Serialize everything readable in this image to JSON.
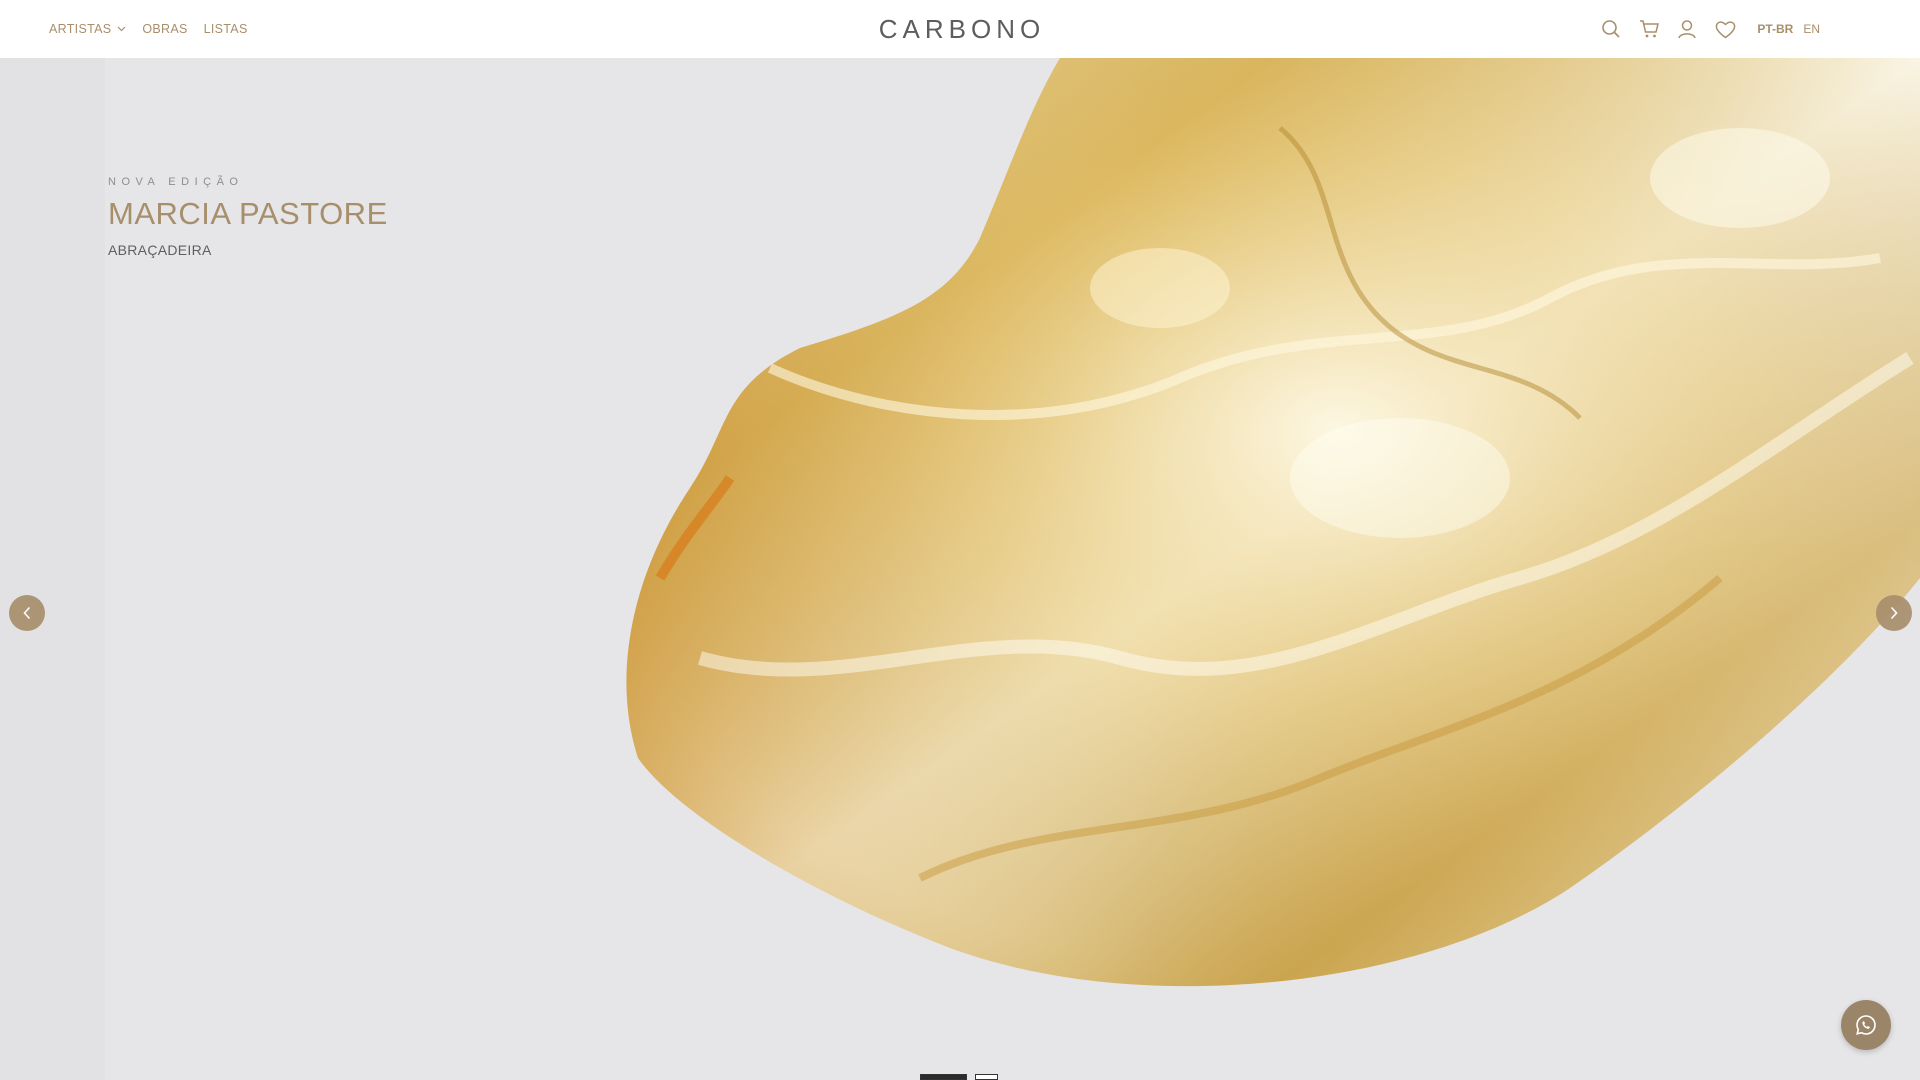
{
  "header": {
    "logo": "CARBONO",
    "nav": [
      {
        "label": "ARTISTAS",
        "has_dropdown": true
      },
      {
        "label": "OBRAS",
        "has_dropdown": false
      },
      {
        "label": "LISTAS",
        "has_dropdown": false
      }
    ],
    "tools": [
      "search-icon",
      "cart-icon",
      "user-icon",
      "heart-icon"
    ],
    "languages": [
      {
        "label": "PT-BR",
        "active": true
      },
      {
        "label": "EN",
        "active": false
      }
    ]
  },
  "hero": {
    "kicker": "NOVA EDIÇÃO",
    "artist": "MARCIA PASTORE",
    "work": "ABRAÇADEIRA",
    "slides_total": 2,
    "active_slide": 1
  },
  "colors": {
    "accent": "#a88f6c",
    "background": "#e6e5e8",
    "gold": "#d9b85a"
  },
  "floating": {
    "whatsapp_icon": "whatsapp-icon"
  }
}
